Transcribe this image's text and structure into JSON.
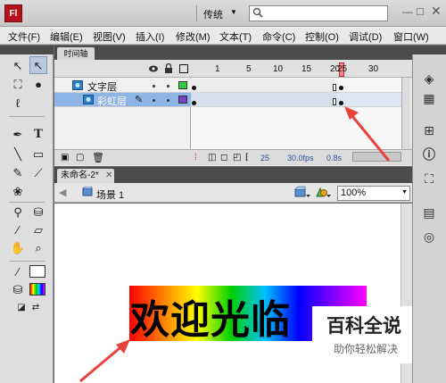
{
  "app": {
    "logo": "Fl",
    "workspace": "传统",
    "search_placeholder": ""
  },
  "menu": [
    "文件(F)",
    "编辑(E)",
    "视图(V)",
    "插入(I)",
    "修改(M)",
    "文本(T)",
    "命令(C)",
    "控制(O)",
    "调试(D)",
    "窗口(W)"
  ],
  "timeline": {
    "tab": "时间轴",
    "frame_numbers": [
      "1",
      "5",
      "10",
      "15",
      "20",
      "25",
      "30"
    ],
    "current_frame": "25",
    "layers": [
      {
        "name": "文字层",
        "color": "#2ecc40"
      },
      {
        "name": "彩虹层",
        "color": "#7b3fc8"
      }
    ],
    "status": {
      "frame": "25",
      "fps": "30.0fps",
      "time": "0.8s"
    }
  },
  "document": {
    "tab": "未命名-2*",
    "scene": "场景 1",
    "zoom": "100%"
  },
  "stage": {
    "text": "欢迎光临"
  },
  "watermark": {
    "title": "百科全说",
    "subtitle": "助你轻松解决"
  },
  "colors": {
    "accent_red": "#e8423a",
    "selection": "#8fb4e6"
  }
}
